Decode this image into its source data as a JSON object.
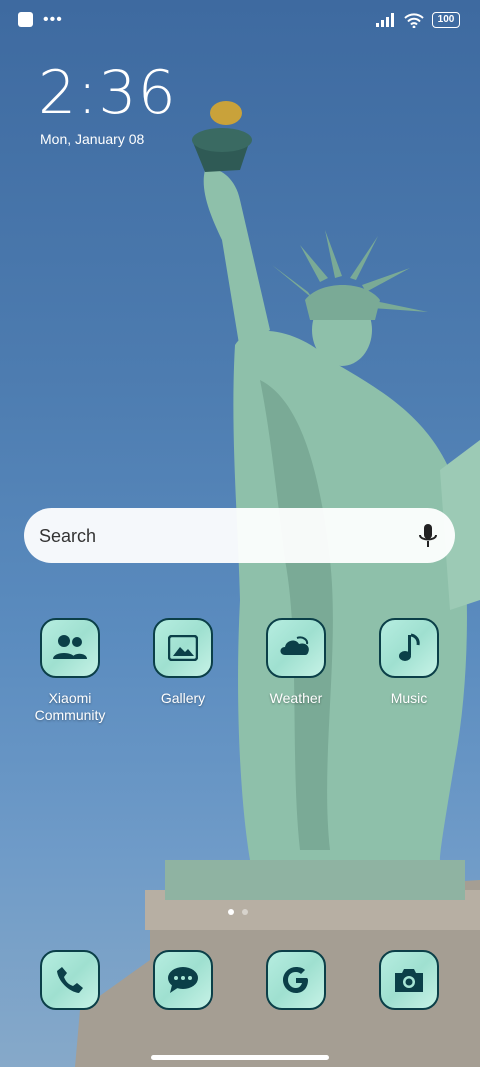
{
  "status": {
    "battery": "100"
  },
  "lockscreen": {
    "time": "2:36",
    "date": "Mon, January 08"
  },
  "search": {
    "placeholder": "Search"
  },
  "apps": [
    {
      "label": "Xiaomi Community",
      "icon": "people-icon"
    },
    {
      "label": "Gallery",
      "icon": "image-icon"
    },
    {
      "label": "Weather",
      "icon": "cloud-icon"
    },
    {
      "label": "Music",
      "icon": "music-note-icon"
    }
  ],
  "dock": [
    {
      "icon": "phone-icon"
    },
    {
      "icon": "messages-icon"
    },
    {
      "icon": "google-icon"
    },
    {
      "icon": "camera-icon"
    }
  ],
  "colors": {
    "icon_bg": "#a8e6d6",
    "icon_border": "#0b3f48",
    "sky": "#4d7cb0"
  }
}
